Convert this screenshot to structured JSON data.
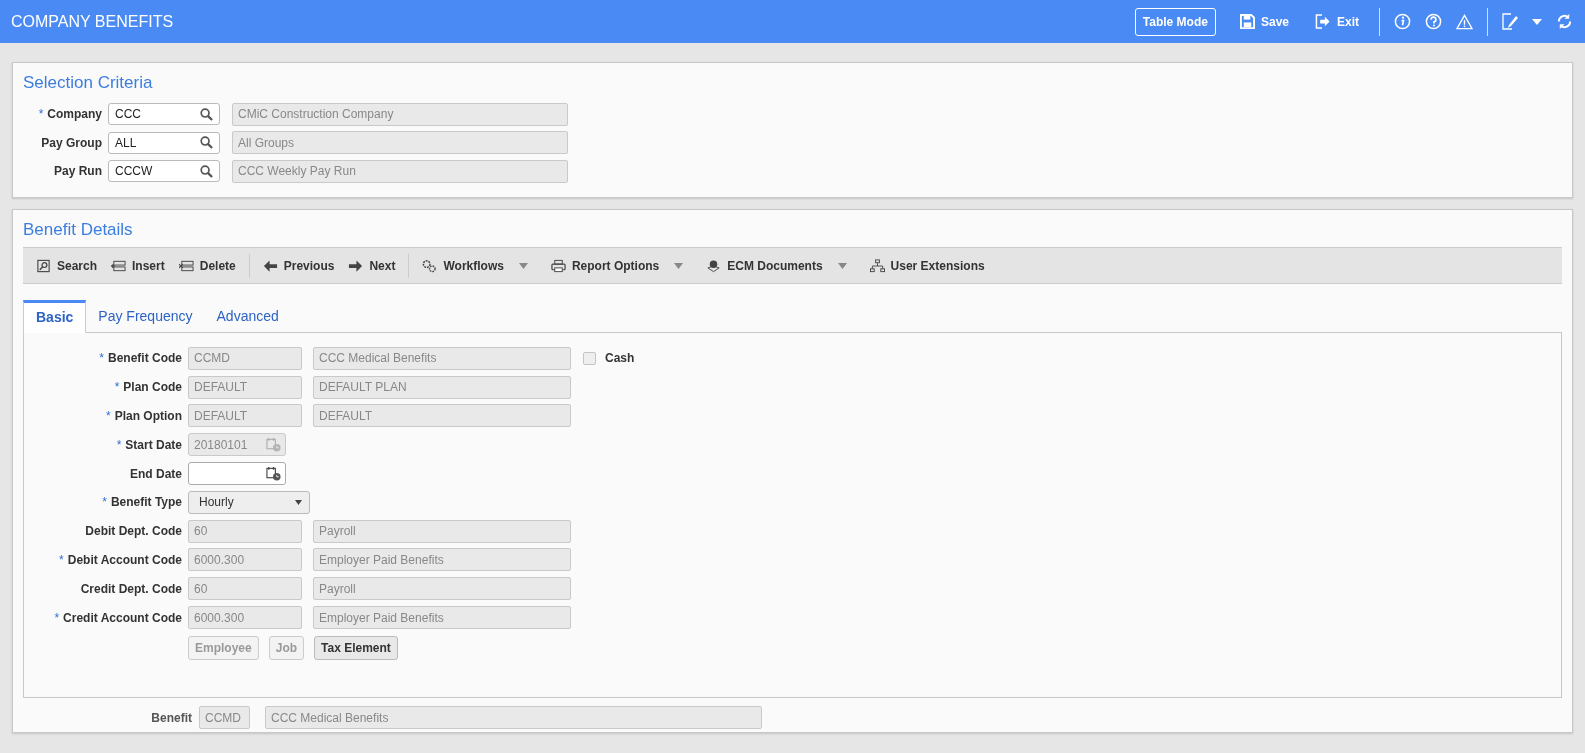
{
  "header": {
    "title": "COMPANY BENEFITS",
    "table_mode": "Table Mode",
    "save": "Save",
    "exit": "Exit"
  },
  "selection": {
    "title": "Selection Criteria",
    "rows": [
      {
        "mark": "*",
        "label": "Company",
        "value": "CCC",
        "description": "CMiC Construction Company"
      },
      {
        "label": "Pay Group",
        "value": "ALL",
        "description": "All Groups"
      },
      {
        "label": "Pay Run",
        "value": "CCCW",
        "description": "CCC Weekly Pay Run"
      }
    ]
  },
  "details": {
    "title": "Benefit Details",
    "toolbar": [
      {
        "label": "Search",
        "caret": false
      },
      {
        "label": "Insert",
        "caret": false
      },
      {
        "label": "Delete",
        "caret": false
      },
      {
        "label": "Previous",
        "caret": false
      },
      {
        "label": "Next",
        "caret": false
      },
      {
        "label": "Workflows",
        "caret": true
      },
      {
        "label": "Report Options",
        "caret": true
      },
      {
        "label": "ECM Documents",
        "caret": true
      },
      {
        "label": "User Extensions",
        "caret": false
      }
    ],
    "tabs": [
      {
        "label": "Basic",
        "selected": true
      },
      {
        "label": "Pay Frequency",
        "selected": false
      },
      {
        "label": "Advanced",
        "selected": false
      }
    ],
    "rows": [
      {
        "mark": "*",
        "label": "Benefit Code",
        "kind": "text",
        "value": "CCMD",
        "description": "CCC Medical Benefits",
        "checkbox": {
          "label": "Cash",
          "checked": false
        }
      },
      {
        "mark": "*",
        "label": "Plan Code",
        "kind": "text",
        "value": "DEFAULT",
        "description": "DEFAULT PLAN"
      },
      {
        "mark": "*",
        "label": "Plan Option",
        "kind": "text",
        "value": "DEFAULT",
        "description": "DEFAULT"
      },
      {
        "mark": "*",
        "label": "Start Date",
        "kind": "date",
        "value": "20180101",
        "disabled": true
      },
      {
        "label": "End Date",
        "kind": "date",
        "disabled": false
      },
      {
        "mark": "*",
        "label": "Benefit Type",
        "kind": "select",
        "value": "Hourly"
      },
      {
        "label": "Debit Dept. Code",
        "kind": "text",
        "value": "60",
        "description": "Payroll"
      },
      {
        "mark": "*",
        "label": "Debit Account Code",
        "kind": "text",
        "value": "6000.300",
        "description": "Employer Paid Benefits"
      },
      {
        "label": "Credit Dept. Code",
        "kind": "text",
        "value": "60",
        "description": "Payroll"
      },
      {
        "mark": "*",
        "label": "Credit Account Code",
        "kind": "text",
        "value": "6000.300",
        "description": "Employer Paid Benefits"
      }
    ],
    "buttons": [
      {
        "label": "Employee",
        "disabled": true
      },
      {
        "label": "Job",
        "disabled": true
      },
      {
        "label": "Tax Element",
        "disabled": false
      }
    ],
    "footer": {
      "label": "Benefit",
      "value": "CCMD",
      "description": "CCC Medical Benefits"
    }
  }
}
